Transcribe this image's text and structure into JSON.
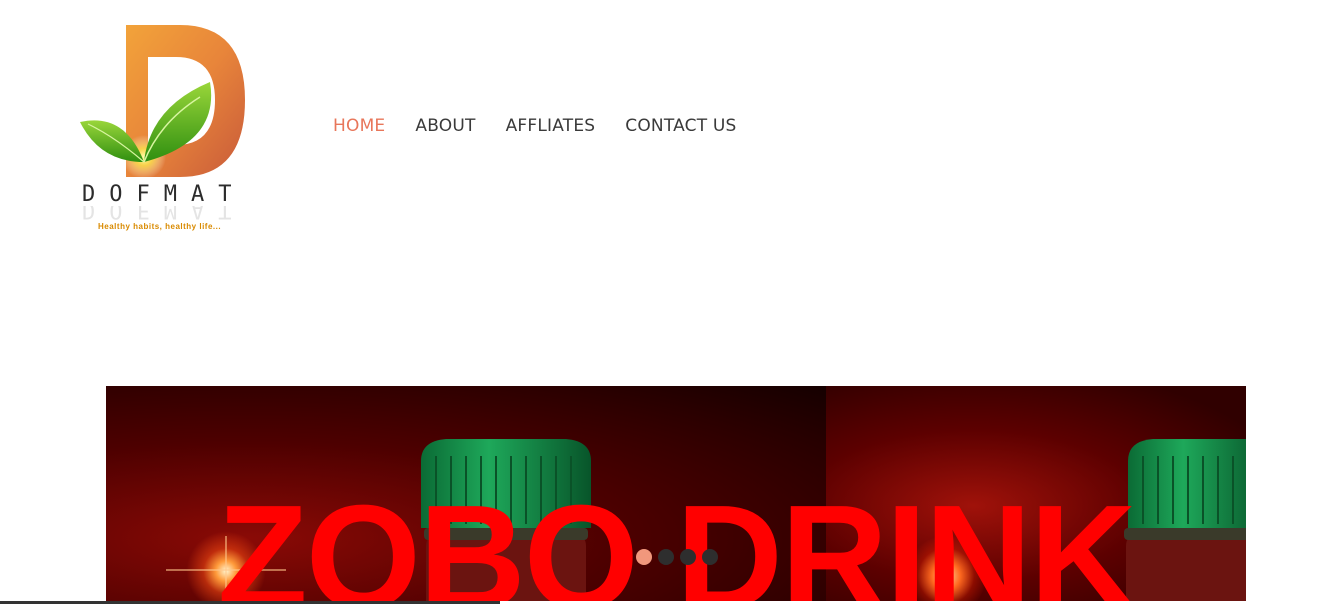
{
  "brand": {
    "name": "DOFMAT",
    "tagline": "Healthy habits, healthy life...",
    "logo_icon": "leaf-d-logo-icon",
    "colors": {
      "d_orange": "#e89b3c",
      "leaf_green": "#5fbf1e"
    }
  },
  "nav": {
    "items": [
      {
        "label": "HOME",
        "active": true
      },
      {
        "label": "ABOUT",
        "active": false
      },
      {
        "label": "AFFLIATES",
        "active": false
      },
      {
        "label": "CONTACT US",
        "active": false
      }
    ],
    "active_color": "#e8765a",
    "text_color": "#3a3a3a"
  },
  "slider": {
    "title": "ZOBO DRINK",
    "title_color": "#ff0000",
    "dots": {
      "count": 4,
      "active_index": 0,
      "active_color": "#f1977c"
    }
  }
}
